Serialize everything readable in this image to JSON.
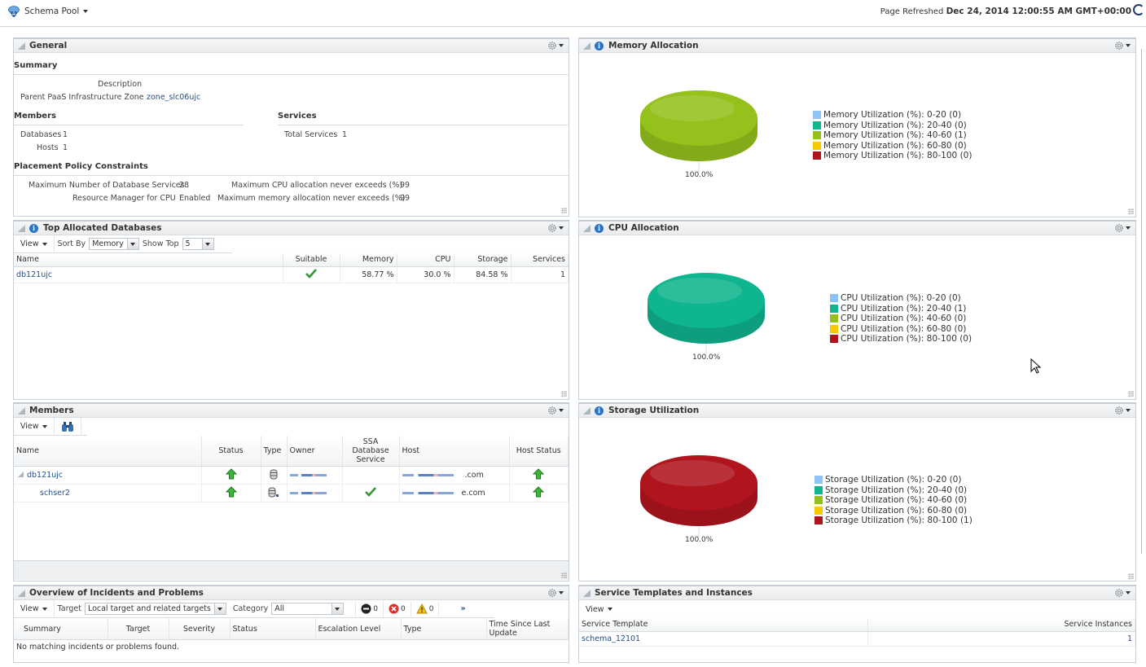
{
  "header": {
    "target_name": "Schema Pool",
    "target_icon": "cloud-network-icon",
    "refresh_label": "Page Refreshed",
    "refresh_time": "Dec 24, 2014 12:00:55 AM GMT+00:00"
  },
  "general": {
    "title": "General",
    "summary_label": "Summary",
    "description_label": "Description",
    "description_value": "",
    "zone_label": "Parent PaaS Infrastructure Zone",
    "zone_value": "zone_slc06ujc",
    "members_label": "Members",
    "databases_label": "Databases",
    "databases_value": "1",
    "hosts_label": "Hosts",
    "hosts_value": "1",
    "services_label": "Services",
    "total_services_label": "Total Services",
    "total_services_value": "1",
    "placement_label": "Placement Policy Constraints",
    "max_db_services_label": "Maximum Number of Database Services",
    "max_db_services_value": "28",
    "rm_cpu_label": "Resource Manager for CPU",
    "rm_cpu_value": "Enabled",
    "max_cpu_label": "Maximum CPU allocation never exceeds (%)",
    "max_cpu_value": "99",
    "max_mem_label": "Maximum memory allocation never exceeds (%)",
    "max_mem_value": "99"
  },
  "top_db": {
    "title": "Top Allocated Databases",
    "view_label": "View",
    "sort_by_label": "Sort By",
    "sort_by_value": "Memory",
    "show_top_label": "Show Top",
    "show_top_value": "5",
    "columns": [
      "Name",
      "Suitable",
      "Memory",
      "CPU",
      "Storage",
      "Services"
    ],
    "rows": [
      {
        "name": "db121ujc",
        "suitable": "check",
        "memory": "58.77 %",
        "cpu": "30.0 %",
        "storage": "84.58 %",
        "services": "1"
      }
    ]
  },
  "members": {
    "title": "Members",
    "view_label": "View",
    "columns": [
      "Name",
      "Status",
      "Type",
      "Owner",
      "SSA Database Service",
      "Host",
      "Host Status"
    ],
    "rows": [
      {
        "name": "db121ujc",
        "status": "up",
        "type": "database",
        "owner": "(redacted)",
        "ssa": "",
        "host_suffix": ".com",
        "host_status": "up"
      },
      {
        "name": "schser2",
        "status": "up",
        "type": "db-service",
        "owner": "(redacted)",
        "ssa": "check",
        "host_suffix": "e.com",
        "host_status": "up"
      }
    ]
  },
  "incidents": {
    "title": "Overview of Incidents and Problems",
    "view_label": "View",
    "target_label": "Target",
    "target_value": "Local target and related targets",
    "category_label": "Category",
    "category_value": "All",
    "fatal_count": "0",
    "critical_count": "0",
    "warning_count": "0",
    "columns": [
      "Summary",
      "Target",
      "Severity",
      "Status",
      "Escalation Level",
      "Type",
      "Time Since Last Update"
    ],
    "empty_message": "No matching incidents or problems found."
  },
  "service_templates": {
    "title": "Service Templates and Instances",
    "view_label": "View",
    "columns": [
      "Service Template",
      "Service Instances"
    ],
    "rows": [
      {
        "template": "schema_12101",
        "instances": "1"
      }
    ]
  },
  "colors": {
    "bucket_0_20": "#8ec3f5",
    "bucket_20_40": "#0fb58e",
    "bucket_40_60": "#94c11c",
    "bucket_60_80": "#f5c800",
    "bucket_80_100": "#b0151e"
  },
  "chart_data": [
    {
      "type": "pie",
      "title": "Memory Allocation",
      "categories": [
        "Memory Utilization (%): 0-20 (0)",
        "Memory Utilization (%): 20-40 (0)",
        "Memory Utilization (%): 40-60 (1)",
        "Memory Utilization (%): 60-80 (0)",
        "Memory Utilization (%): 80-100 (0)"
      ],
      "values": [
        0,
        0,
        1,
        0,
        0
      ],
      "data_label": "100.0%",
      "legend": "right"
    },
    {
      "type": "pie",
      "title": "CPU Allocation",
      "categories": [
        "CPU Utilization (%): 0-20 (0)",
        "CPU Utilization (%): 20-40 (1)",
        "CPU Utilization (%): 40-60 (0)",
        "CPU Utilization (%): 60-80 (0)",
        "CPU Utilization (%): 80-100 (0)"
      ],
      "values": [
        0,
        1,
        0,
        0,
        0
      ],
      "data_label": "100.0%",
      "legend": "right"
    },
    {
      "type": "pie",
      "title": "Storage Utilization",
      "categories": [
        "Storage Utilization (%): 0-20 (0)",
        "Storage Utilization (%): 20-40 (0)",
        "Storage Utilization (%): 40-60 (0)",
        "Storage Utilization (%): 60-80 (0)",
        "Storage Utilization (%): 80-100 (1)"
      ],
      "values": [
        0,
        0,
        0,
        0,
        1
      ],
      "data_label": "100.0%",
      "legend": "right"
    }
  ]
}
